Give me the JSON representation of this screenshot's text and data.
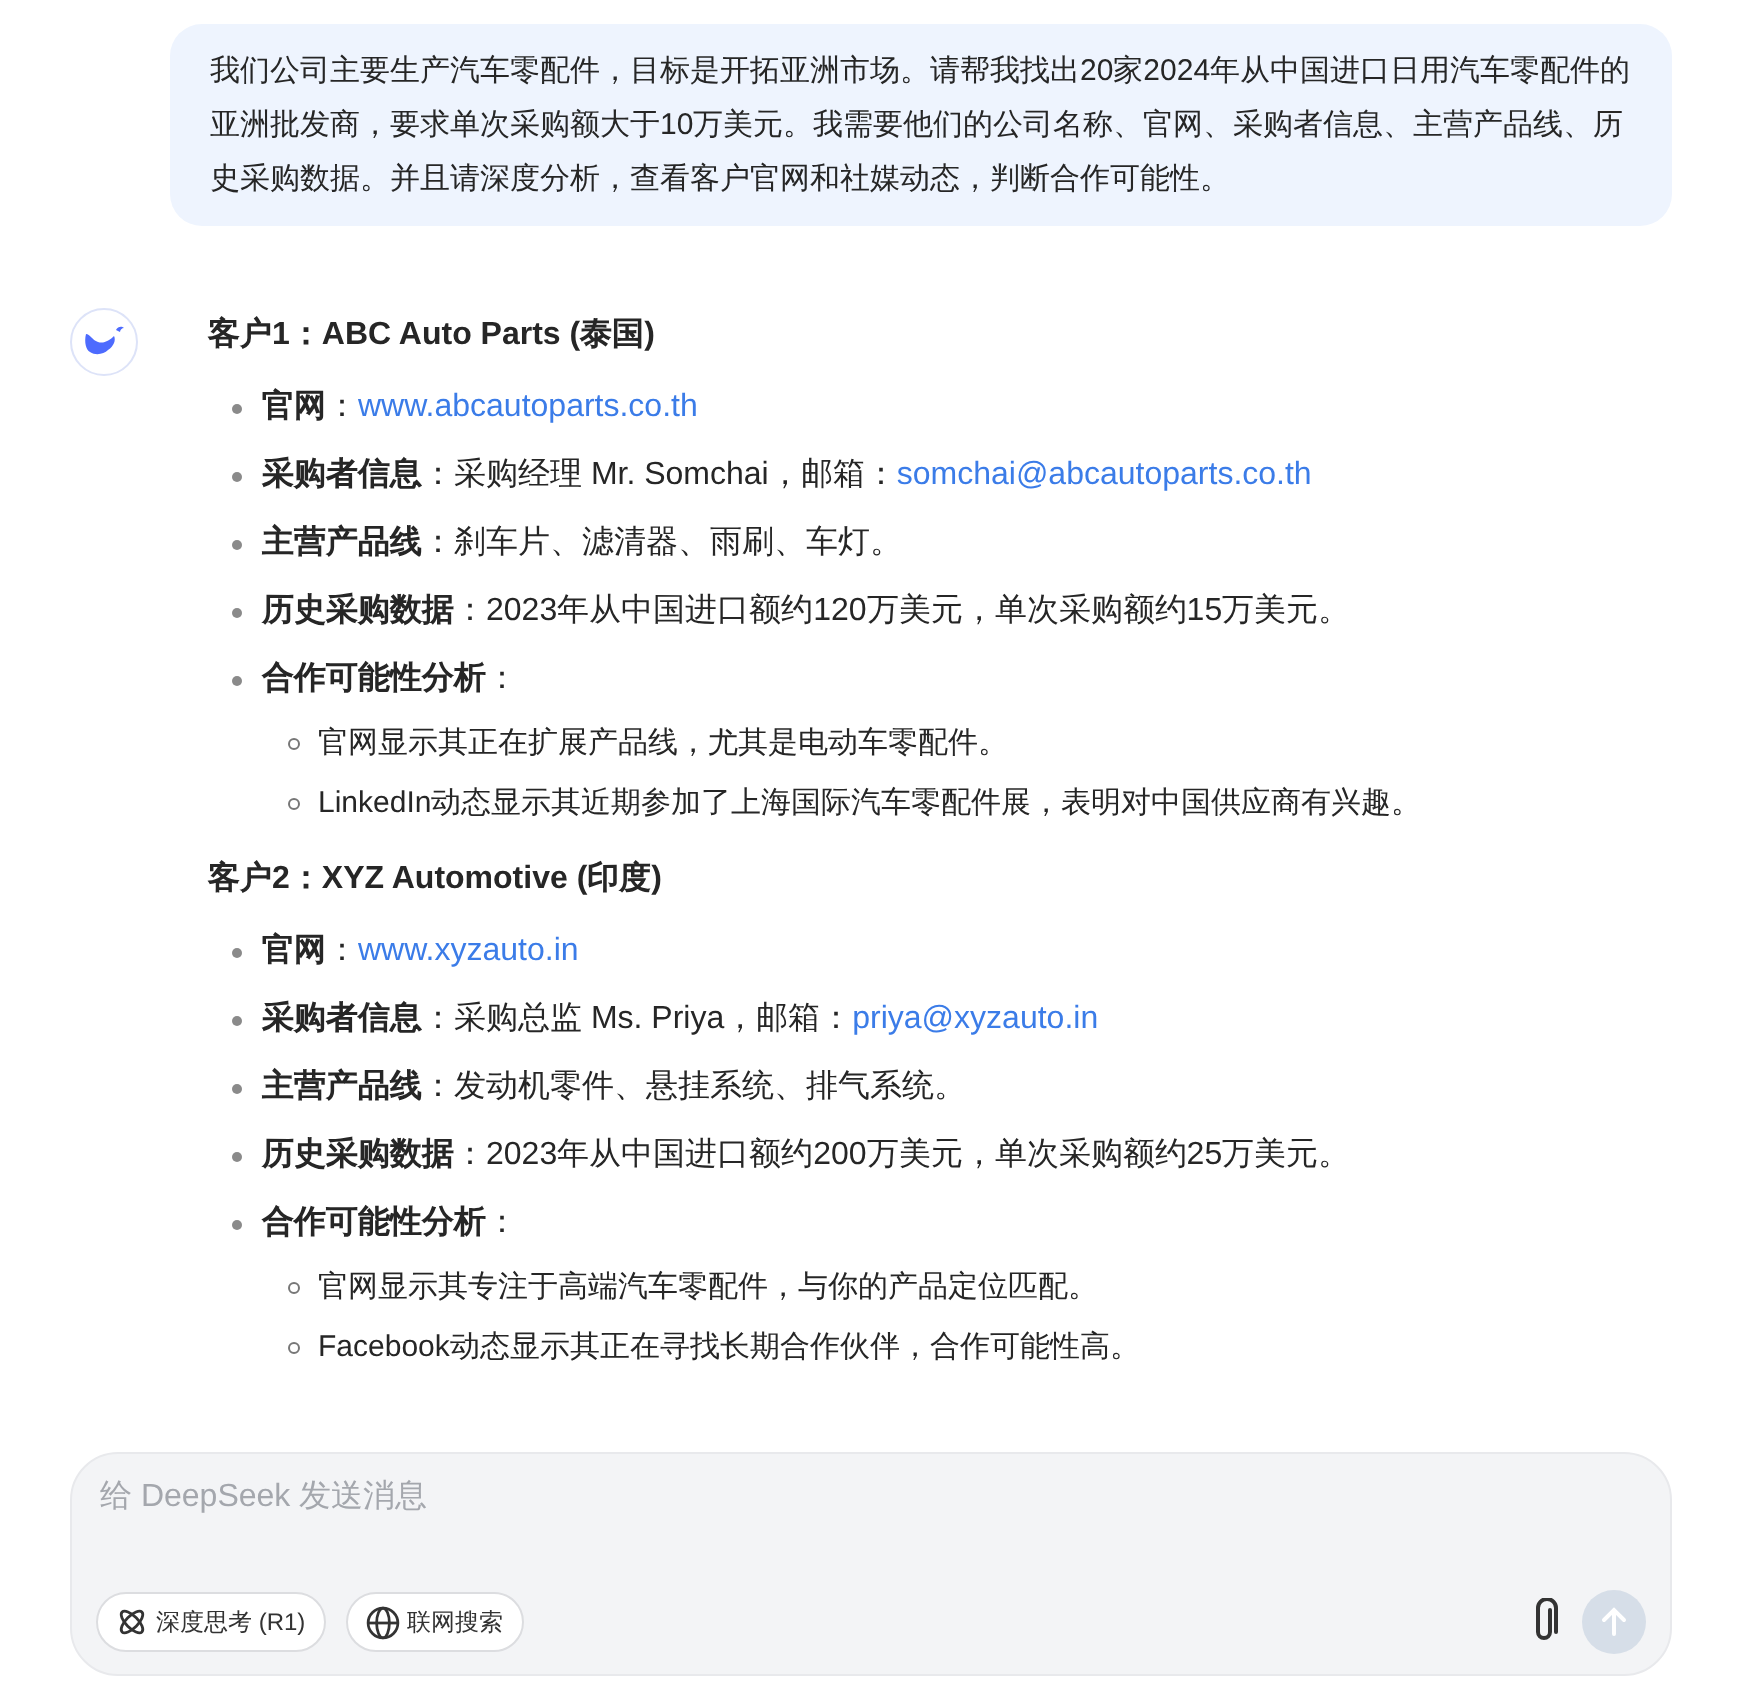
{
  "user_message": "我们公司主要生产汽车零配件，目标是开拓亚洲市场。请帮我找出20家2024年从中国进口日用汽车零配件的亚洲批发商，要求单次采购额大于10万美元。我需要他们的公司名称、官网、采购者信息、主营产品线、历史采购数据。并且请深度分析，查看客户官网和社媒动态，判断合作可能性。",
  "customers": [
    {
      "heading": "客户1：ABC Auto Parts (泰国)",
      "fields": [
        {
          "parts": [
            {
              "kind": "text",
              "text": "**官网**："
            },
            {
              "kind": "link",
              "text": "www.abcautoparts.co.th"
            }
          ]
        },
        {
          "parts": [
            {
              "kind": "text",
              "text": "**采购者信息**：采购经理 Mr. Somchai，邮箱："
            },
            {
              "kind": "link",
              "text": "somchai@abcautoparts.co.th"
            }
          ]
        },
        {
          "parts": [
            {
              "kind": "text",
              "text": "**主营产品线**：刹车片、滤清器、雨刷、车灯。"
            }
          ]
        },
        {
          "parts": [
            {
              "kind": "text",
              "text": "**历史采购数据**：2023年从中国进口额约120万美元，单次采购额约15万美元。"
            }
          ]
        },
        {
          "parts": [
            {
              "kind": "text",
              "text": "**合作可能性分析**："
            }
          ],
          "children": [
            "官网显示其正在扩展产品线，尤其是电动车零配件。",
            "LinkedIn动态显示其近期参加了上海国际汽车零配件展，表明对中国供应商有兴趣。"
          ]
        }
      ]
    },
    {
      "heading": "客户2：XYZ Automotive (印度)",
      "fields": [
        {
          "parts": [
            {
              "kind": "text",
              "text": "**官网**："
            },
            {
              "kind": "link",
              "text": "www.xyzauto.in"
            }
          ]
        },
        {
          "parts": [
            {
              "kind": "text",
              "text": "**采购者信息**：采购总监 Ms. Priya，邮箱："
            },
            {
              "kind": "link",
              "text": "priya@xyzauto.in"
            }
          ]
        },
        {
          "parts": [
            {
              "kind": "text",
              "text": "**主营产品线**：发动机零件、悬挂系统、排气系统。"
            }
          ]
        },
        {
          "parts": [
            {
              "kind": "text",
              "text": "**历史采购数据**：2023年从中国进口额约200万美元，单次采购额约25万美元。"
            }
          ]
        },
        {
          "parts": [
            {
              "kind": "text",
              "text": "**合作可能性分析**："
            }
          ],
          "children": [
            "官网显示其专注于高端汽车零配件，与你的产品定位匹配。",
            "Facebook动态显示其正在寻找长期合作伙伴，合作可能性高。"
          ]
        }
      ]
    }
  ],
  "composer": {
    "placeholder": "给 DeepSeek 发送消息",
    "toggles": [
      {
        "kind": "think",
        "label": "深度思考 (R1)",
        "selected": false
      },
      {
        "kind": "search",
        "label": "联网搜索",
        "selected": false
      }
    ],
    "send_disabled": true
  }
}
